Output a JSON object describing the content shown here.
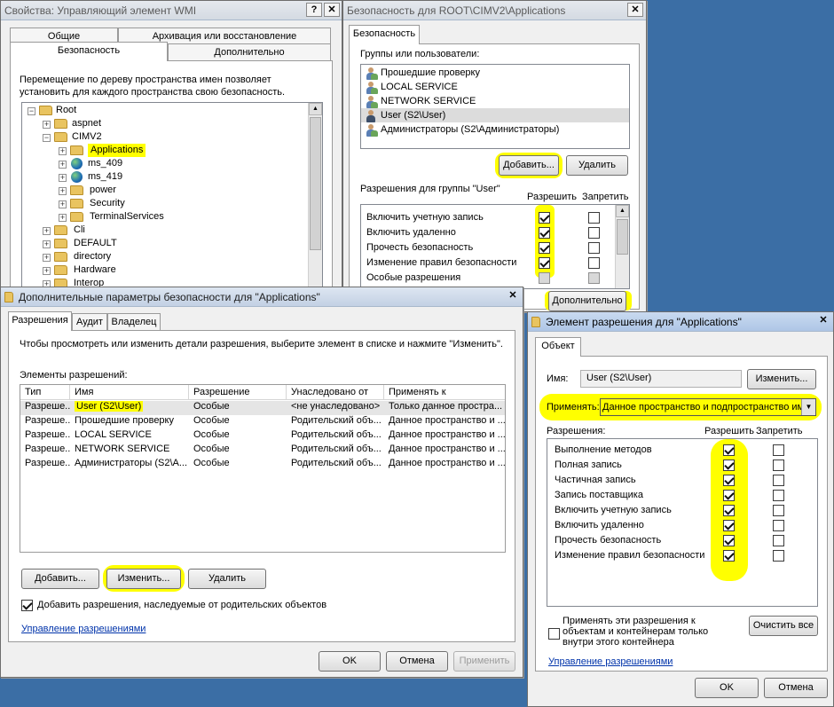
{
  "wmi": {
    "title": "Свойства: Управляющий элемент WMI",
    "tabs_row1": [
      "Общие",
      "Архивация или восстановление"
    ],
    "tabs_row2": [
      "Безопасность",
      "Дополнительно"
    ],
    "description": "Перемещение по дереву пространства имен позволяет установить для каждого пространства свою безопасность.",
    "tree": [
      {
        "label": "Root"
      },
      {
        "label": "aspnet"
      },
      {
        "label": "CIMV2"
      },
      {
        "label": "Applications"
      },
      {
        "label": "ms_409"
      },
      {
        "label": "ms_419"
      },
      {
        "label": "power"
      },
      {
        "label": "Security"
      },
      {
        "label": "TerminalServices"
      },
      {
        "label": "Cli"
      },
      {
        "label": "DEFAULT"
      },
      {
        "label": "directory"
      },
      {
        "label": "Hardware"
      },
      {
        "label": "Interop"
      }
    ]
  },
  "sec": {
    "title": "Безопасность для ROOT\\CIMV2\\Applications",
    "tab": "Безопасность",
    "groups_label": "Группы или пользователи:",
    "users": [
      {
        "name": "Прошедшие проверку"
      },
      {
        "name": "LOCAL SERVICE"
      },
      {
        "name": "NETWORK SERVICE"
      },
      {
        "name": "User (S2\\User)"
      },
      {
        "name": "Администраторы (S2\\Администраторы)"
      }
    ],
    "add_btn": "Добавить...",
    "remove_btn": "Удалить",
    "perm_label": "Разрешения для группы \"User\"",
    "allow_hdr": "Разрешить",
    "deny_hdr": "Запретить",
    "permissions": [
      {
        "name": "Включить учетную запись",
        "allow": true,
        "deny": false
      },
      {
        "name": "Включить удаленно",
        "allow": true,
        "deny": false
      },
      {
        "name": "Прочесть безопасность",
        "allow": true,
        "deny": false
      },
      {
        "name": "Изменение правил безопасности",
        "allow": true,
        "deny": false
      },
      {
        "name": "Особые разрешения",
        "allow": false,
        "deny": false
      }
    ],
    "advanced_btn": "Дополнительно"
  },
  "adv": {
    "title": "Дополнительные параметры безопасности для \"Applications\"",
    "tabs": [
      "Разрешения",
      "Аудит",
      "Владелец"
    ],
    "instruction": "Чтобы просмотреть или изменить детали разрешения, выберите элемент в списке и нажмите \"Изменить\".",
    "entries_label": "Элементы разрешений:",
    "columns": [
      "Тип",
      "Имя",
      "Разрешение",
      "Унаследовано от",
      "Применять к"
    ],
    "rows": [
      [
        "Разреше...",
        "User (S2\\User)",
        "Особые",
        "<не унаследовано>",
        "Только данное простра..."
      ],
      [
        "Разреше...",
        "Прошедшие проверку",
        "Особые",
        "Родительский объ...",
        "Данное пространство и ..."
      ],
      [
        "Разреше...",
        "LOCAL SERVICE",
        "Особые",
        "Родительский объ...",
        "Данное пространство и ..."
      ],
      [
        "Разреше...",
        "NETWORK SERVICE",
        "Особые",
        "Родительский объ...",
        "Данное пространство и ..."
      ],
      [
        "Разреше...",
        "Администраторы (S2\\А...",
        "Особые",
        "Родительский объ...",
        "Данное пространство и ..."
      ]
    ],
    "add_btn": "Добавить...",
    "edit_btn": "Изменить...",
    "remove_btn": "Удалить",
    "inherit_label": "Добавить разрешения, наследуемые от родительских объектов",
    "inherit_checked": true,
    "manage_link": "Управление разрешениями",
    "ok": "OK",
    "cancel": "Отмена",
    "apply": "Применить"
  },
  "elem": {
    "title": "Элемент разрешения для \"Applications\"",
    "tab": "Объект",
    "name_label": "Имя:",
    "name_value": "User (S2\\User)",
    "change_btn": "Изменить...",
    "apply_to_label": "Применять:",
    "apply_to_value": "Данное пространство и подпространство имен",
    "perms_label": "Разрешения:",
    "allow_hdr": "Разрешить",
    "deny_hdr": "Запретить",
    "permissions": [
      {
        "name": "Выполнение методов",
        "allow": true,
        "deny": false
      },
      {
        "name": "Полная запись",
        "allow": true,
        "deny": false
      },
      {
        "name": "Частичная запись",
        "allow": true,
        "deny": false
      },
      {
        "name": "Запись поставщика",
        "allow": true,
        "deny": false
      },
      {
        "name": "Включить учетную запись",
        "allow": true,
        "deny": false
      },
      {
        "name": "Включить удаленно",
        "allow": true,
        "deny": false
      },
      {
        "name": "Прочесть безопасность",
        "allow": true,
        "deny": false
      },
      {
        "name": "Изменение правил безопасности",
        "allow": true,
        "deny": false
      }
    ],
    "inherit_text": "Применять эти разрешения к объектам и контейнерам только внутри этого контейнера",
    "clear_btn": "Очистить все",
    "manage_link": "Управление разрешениями",
    "ok": "OK",
    "cancel": "Отмена"
  }
}
